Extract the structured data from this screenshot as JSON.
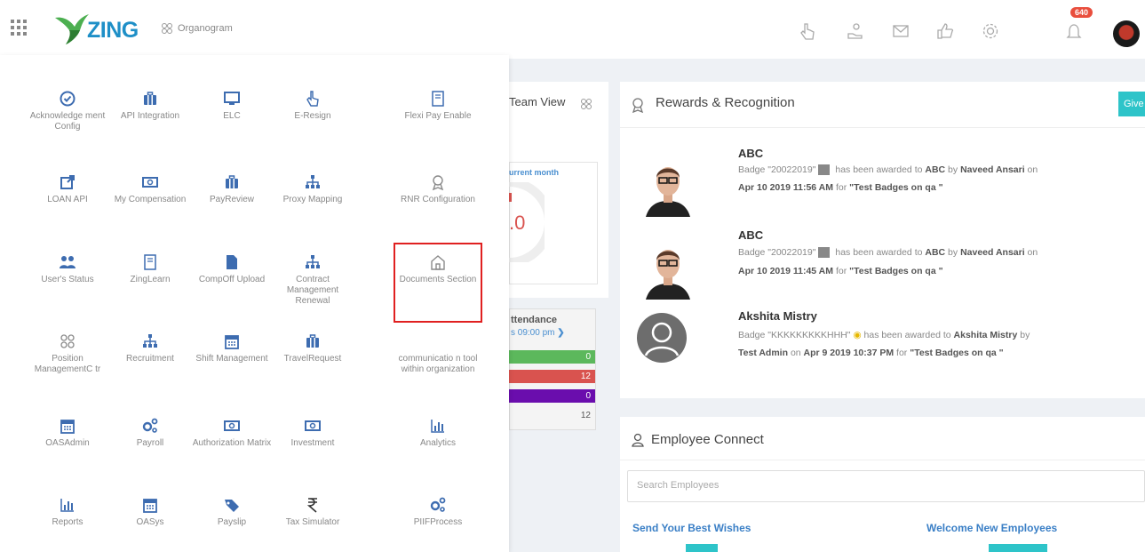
{
  "header": {
    "logo_text": "ZING",
    "organogram_label": "Organogram",
    "notification_count": "640"
  },
  "menu": {
    "items": [
      {
        "label": "Acknowledge ment Config",
        "icon": "check-circle-icon"
      },
      {
        "label": "API Integration",
        "icon": "briefcase-icon"
      },
      {
        "label": "ELC",
        "icon": "monitor-icon"
      },
      {
        "label": "E-Resign",
        "icon": "hand-pointer-icon"
      },
      {
        "label": "Flexi Pay Enable",
        "icon": "document-icon"
      },
      {
        "label": "LOAN API",
        "icon": "external-link-icon"
      },
      {
        "label": "My Compensation",
        "icon": "money-icon"
      },
      {
        "label": "PayReview",
        "icon": "briefcase-icon"
      },
      {
        "label": "Proxy Mapping",
        "icon": "sitemap-icon"
      },
      {
        "label": "RNR Configuration",
        "icon": "award-icon"
      },
      {
        "label": "User's Status",
        "icon": "users-icon"
      },
      {
        "label": "ZingLearn",
        "icon": "document-icon"
      },
      {
        "label": "CompOff Upload",
        "icon": "file-icon"
      },
      {
        "label": "Contract Management Renewal",
        "icon": "sitemap-icon"
      },
      {
        "label": "Documents Section",
        "icon": "home-icon"
      },
      {
        "label": "Position ManagementC tr",
        "icon": "org-people-icon"
      },
      {
        "label": "Recruitment",
        "icon": "sitemap-icon"
      },
      {
        "label": "Shift Management",
        "icon": "calendar-icon"
      },
      {
        "label": "TravelRequest",
        "icon": "briefcase-icon"
      },
      {
        "label": "communicatio n tool within organization",
        "icon": "none"
      },
      {
        "label": "OASAdmin",
        "icon": "calendar-icon"
      },
      {
        "label": "Payroll",
        "icon": "cogs-icon"
      },
      {
        "label": "Authorization Matrix",
        "icon": "money-icon"
      },
      {
        "label": "Investment",
        "icon": "money-icon"
      },
      {
        "label": "Analytics",
        "icon": "bar-chart-icon"
      },
      {
        "label": "Reports",
        "icon": "bar-chart-icon"
      },
      {
        "label": "OASys",
        "icon": "calendar-icon"
      },
      {
        "label": "Payslip",
        "icon": "tags-icon"
      },
      {
        "label": "Tax Simulator",
        "icon": "rupee-icon"
      },
      {
        "label": "PIIFProcess",
        "icon": "cogs-icon"
      }
    ]
  },
  "team_view": {
    "title": "Team View",
    "current_month": "urrent month",
    "score": ".0"
  },
  "attendance": {
    "title": "ttendance",
    "subtitle": "s 09:00 pm",
    "bars": [
      {
        "value": "0",
        "color": "#5cb85c"
      },
      {
        "value": "12",
        "color": "#d9534f"
      },
      {
        "value": "0",
        "color": "#6a0dad"
      },
      {
        "value": "12",
        "color": "#f4f4f4"
      }
    ]
  },
  "rewards": {
    "title": "Rewards & Recognition",
    "give_label": "Give",
    "items": [
      {
        "name": "ABC",
        "line1_a": "Badge \"20022019\"",
        "line1_b": "has been awarded to",
        "line1_c": "ABC",
        "line1_d": "by",
        "line1_e": "Naveed Ansari",
        "line1_f": "on",
        "line2_a": "Apr 10 2019 11:56 AM",
        "line2_b": "for",
        "line2_c": "\"Test Badges on qa \""
      },
      {
        "name": "ABC",
        "line1_a": "Badge \"20022019\"",
        "line1_b": "has been awarded to",
        "line1_c": "ABC",
        "line1_d": "by",
        "line1_e": "Naveed Ansari",
        "line1_f": "on",
        "line2_a": "Apr 10 2019 11:45 AM",
        "line2_b": "for",
        "line2_c": "\"Test Badges on qa \""
      },
      {
        "name": "Akshita Mistry",
        "line1_a": "Badge \"KKKKKKKKKHHH\"",
        "line1_b": "has been awarded to",
        "line1_c": "Akshita Mistry",
        "line1_d": "by",
        "line1_e": "",
        "line1_f": "",
        "line2_a": "Test Admin",
        "line2_b": "on",
        "line2_c": "Apr 9 2019 10:37 PM",
        "line2_d": "for",
        "line2_e": "\"Test Badges on qa \""
      }
    ]
  },
  "employee_connect": {
    "title": "Employee Connect",
    "search_placeholder": "Search Employees",
    "best_wishes": "Send Your Best Wishes",
    "welcome": "Welcome New Employees"
  }
}
